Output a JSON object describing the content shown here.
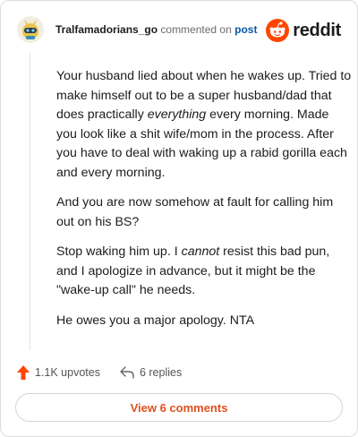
{
  "comment": {
    "author": "Tralfamadorians_go",
    "action_text": "commented on",
    "post_link_label": "post",
    "brand_name": "reddit",
    "paragraphs": [
      {
        "before": "Your husband lied about when he wakes up. Tried to make himself out to be a super husband/dad that does practically ",
        "emphasis": "everything",
        "after": " every morning. Made you look like a shit wife/mom in the process. After you have to deal with waking up a rabid gorilla each and every morning."
      },
      {
        "before": "And you are now somehow at fault for calling him out on his BS?",
        "emphasis": "",
        "after": ""
      },
      {
        "before": "Stop waking him up. I ",
        "emphasis": "cannot",
        "after": " resist this bad pun, and I apologize in advance, but it might be the \"wake-up call\" he needs."
      },
      {
        "before": "He owes you a major apology. NTA",
        "emphasis": "",
        "after": ""
      }
    ],
    "upvotes_label": "1.1K upvotes",
    "replies_label": "6 replies",
    "view_comments_label": "View 6 comments"
  },
  "colors": {
    "brand_orange": "#ff4500",
    "link_blue": "#0a58a8",
    "view_button_text": "#e0501e"
  },
  "icons": {
    "avatar": "snoo-avatar-icon",
    "brand": "reddit-logo-icon",
    "upvote": "upvote-arrow-icon",
    "reply": "reply-arrow-icon"
  }
}
